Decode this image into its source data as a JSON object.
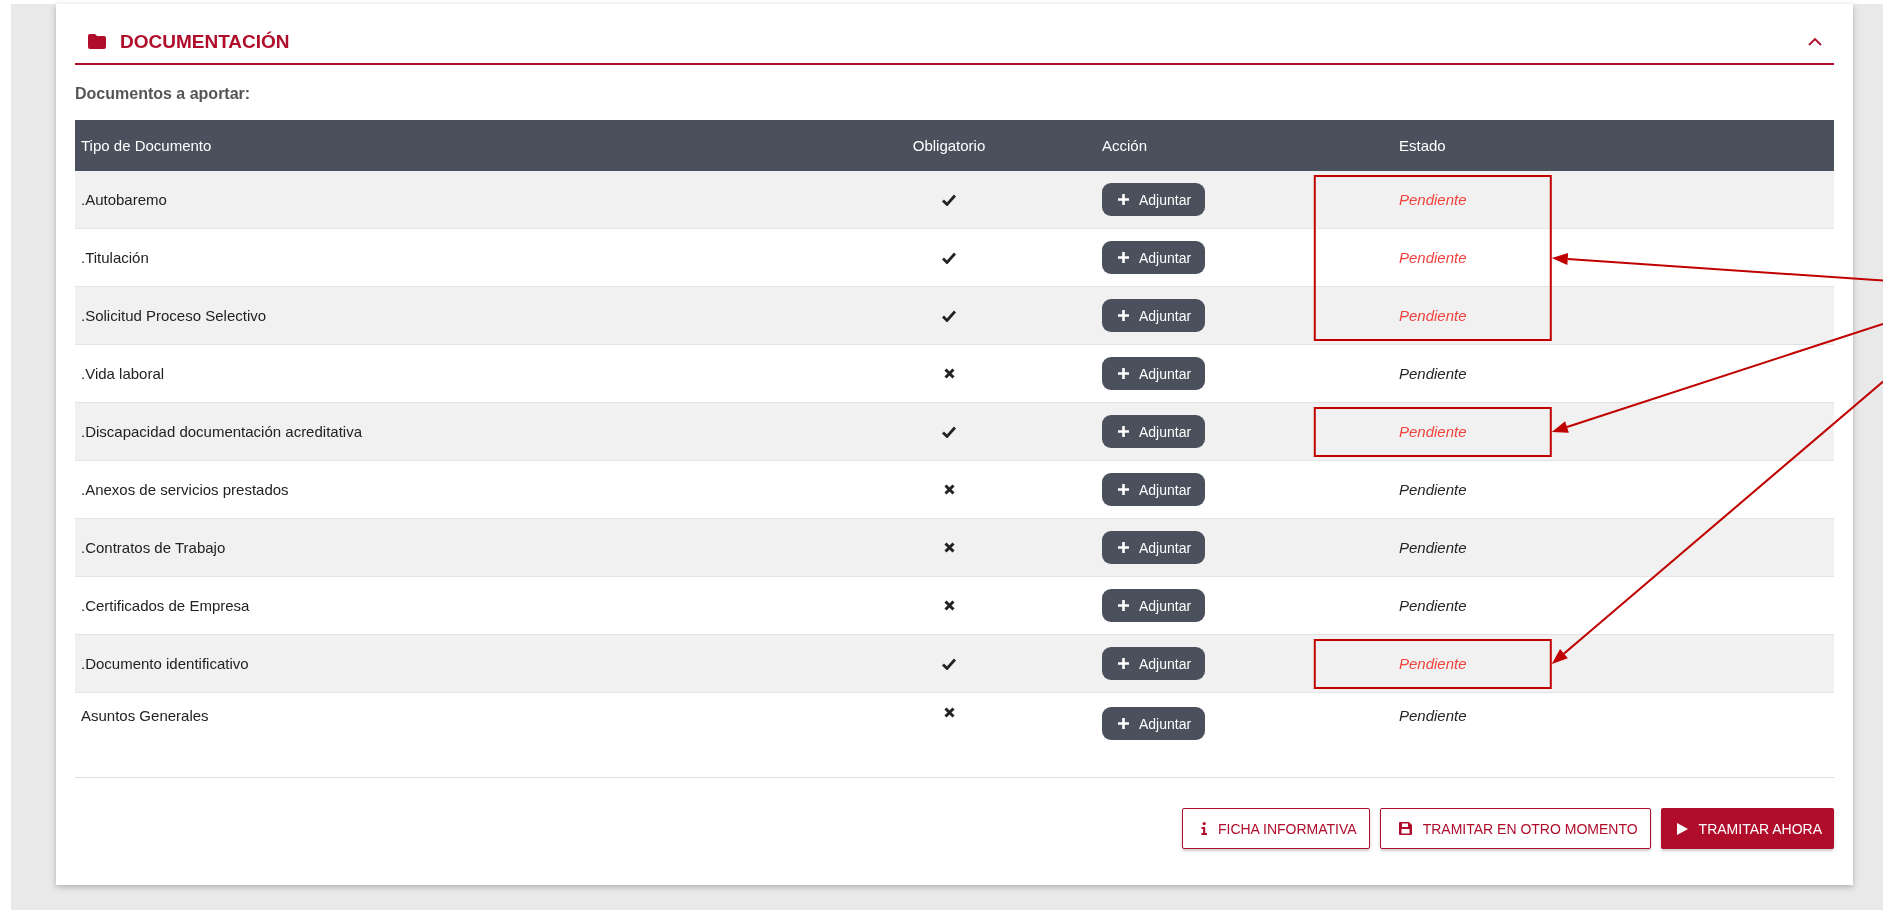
{
  "section": {
    "title": "DOCUMENTACIÓN",
    "expanded": true
  },
  "subtitle": "Documentos a aportar:",
  "table": {
    "columns": [
      "Tipo de Documento",
      "Obligatorio",
      "Acción",
      "Estado"
    ],
    "rows": [
      {
        "document": ".Autobaremo",
        "required": true,
        "action": "Adjuntar",
        "status": "Pendiente",
        "highlighted": true
      },
      {
        "document": ".Titulación",
        "required": true,
        "action": "Adjuntar",
        "status": "Pendiente",
        "highlighted": true
      },
      {
        "document": ".Solicitud Proceso Selectivo",
        "required": true,
        "action": "Adjuntar",
        "status": "Pendiente",
        "highlighted": true
      },
      {
        "document": ".Vida laboral",
        "required": false,
        "action": "Adjuntar",
        "status": "Pendiente",
        "highlighted": false
      },
      {
        "document": ".Discapacidad documentación acreditativa",
        "required": true,
        "action": "Adjuntar",
        "status": "Pendiente",
        "highlighted": true
      },
      {
        "document": ".Anexos de servicios prestados",
        "required": false,
        "action": "Adjuntar",
        "status": "Pendiente",
        "highlighted": false
      },
      {
        "document": ".Contratos de Trabajo",
        "required": false,
        "action": "Adjuntar",
        "status": "Pendiente",
        "highlighted": false
      },
      {
        "document": ".Certificados de Empresa",
        "required": false,
        "action": "Adjuntar",
        "status": "Pendiente",
        "highlighted": false
      },
      {
        "document": ".Documento identificativo",
        "required": true,
        "action": "Adjuntar",
        "status": "Pendiente",
        "highlighted": true
      },
      {
        "document": "Asuntos Generales",
        "required": false,
        "action": "Adjuntar",
        "status": "Pendiente",
        "highlighted": false
      }
    ]
  },
  "buttons": [
    {
      "label": "FICHA INFORMATIVA",
      "kind": "info"
    },
    {
      "label": "TRAMITAR EN OTRO MOMENTO",
      "kind": "save"
    },
    {
      "label": "TRAMITAR AHORA",
      "kind": "submit"
    }
  ]
}
